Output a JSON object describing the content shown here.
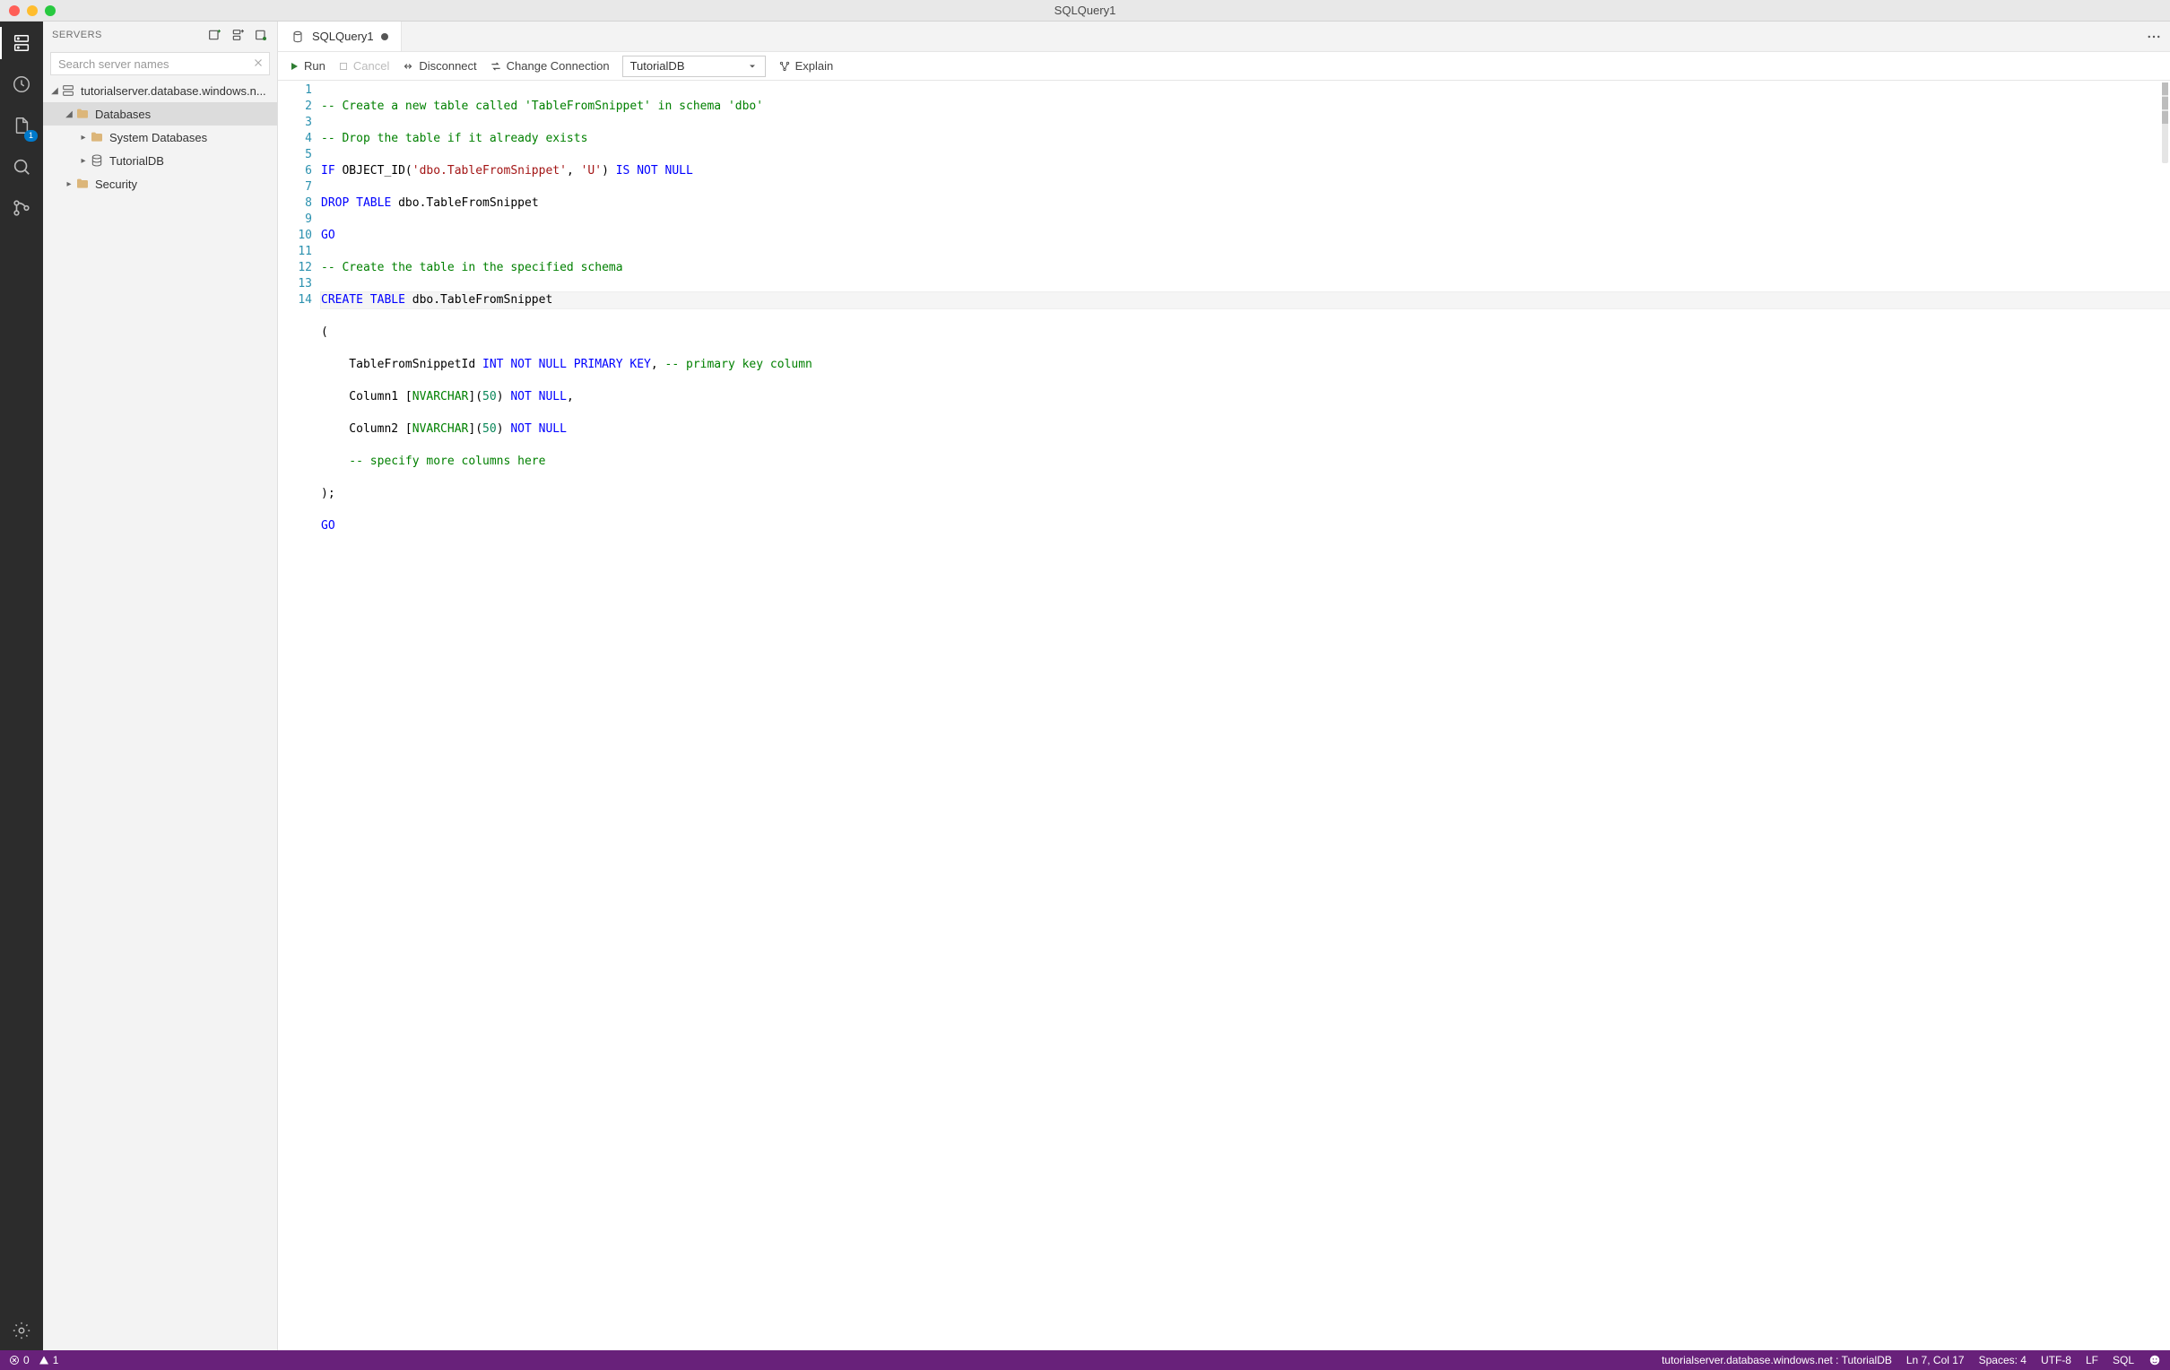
{
  "window": {
    "title": "SQLQuery1"
  },
  "activity": {
    "badge_task_manager": "1"
  },
  "sidebar": {
    "title": "SERVERS",
    "search_placeholder": "Search server names",
    "tree": {
      "server": "tutorialserver.database.windows.n...",
      "databases_label": "Databases",
      "system_label": "System Databases",
      "tutorialdb_label": "TutorialDB",
      "security_label": "Security"
    }
  },
  "tabs": {
    "active": {
      "label": "SQLQuery1"
    }
  },
  "toolbar": {
    "run": "Run",
    "cancel": "Cancel",
    "disconnect": "Disconnect",
    "change_conn": "Change Connection",
    "db_selected": "TutorialDB",
    "explain": "Explain"
  },
  "editor": {
    "line_count": 14,
    "lines": {
      "l1_comment": "-- Create a new table called 'TableFromSnippet' in schema 'dbo'",
      "l2_comment": "-- Drop the table if it already exists",
      "l3_a": "IF",
      "l3_b": " OBJECT_ID(",
      "l3_str1": "'dbo.TableFromSnippet'",
      "l3_c": ", ",
      "l3_str2": "'U'",
      "l3_d": ") ",
      "l3_e": "IS NOT NULL",
      "l4_a": "DROP TABLE",
      "l4_b": " dbo.TableFromSnippet",
      "l5": "GO",
      "l6_comment": "-- Create the table in the specified schema",
      "l7_a": "CREATE TABLE",
      "l7_b": " dbo.TableFromSnippet",
      "l8": "(",
      "l9_a": "    TableFromSnippetId ",
      "l9_b": "INT NOT NULL PRIMARY KEY",
      "l9_c": ", ",
      "l9_comment": "-- primary key column",
      "l10_a": "    Column1 [",
      "l10_type": "NVARCHAR",
      "l10_b": "](",
      "l10_num": "50",
      "l10_c": ") ",
      "l10_d": "NOT NULL",
      "l10_e": ",",
      "l11_a": "    Column2 [",
      "l11_type": "NVARCHAR",
      "l11_b": "](",
      "l11_num": "50",
      "l11_c": ") ",
      "l11_d": "NOT NULL",
      "l12_comment": "    -- specify more columns here",
      "l13": ");",
      "l14": "GO"
    }
  },
  "statusbar": {
    "errors": "0",
    "warnings": "1",
    "connection": "tutorialserver.database.windows.net : TutorialDB",
    "position": "Ln 7, Col 17",
    "spaces": "Spaces: 4",
    "encoding": "UTF-8",
    "eol": "LF",
    "lang": "SQL"
  }
}
